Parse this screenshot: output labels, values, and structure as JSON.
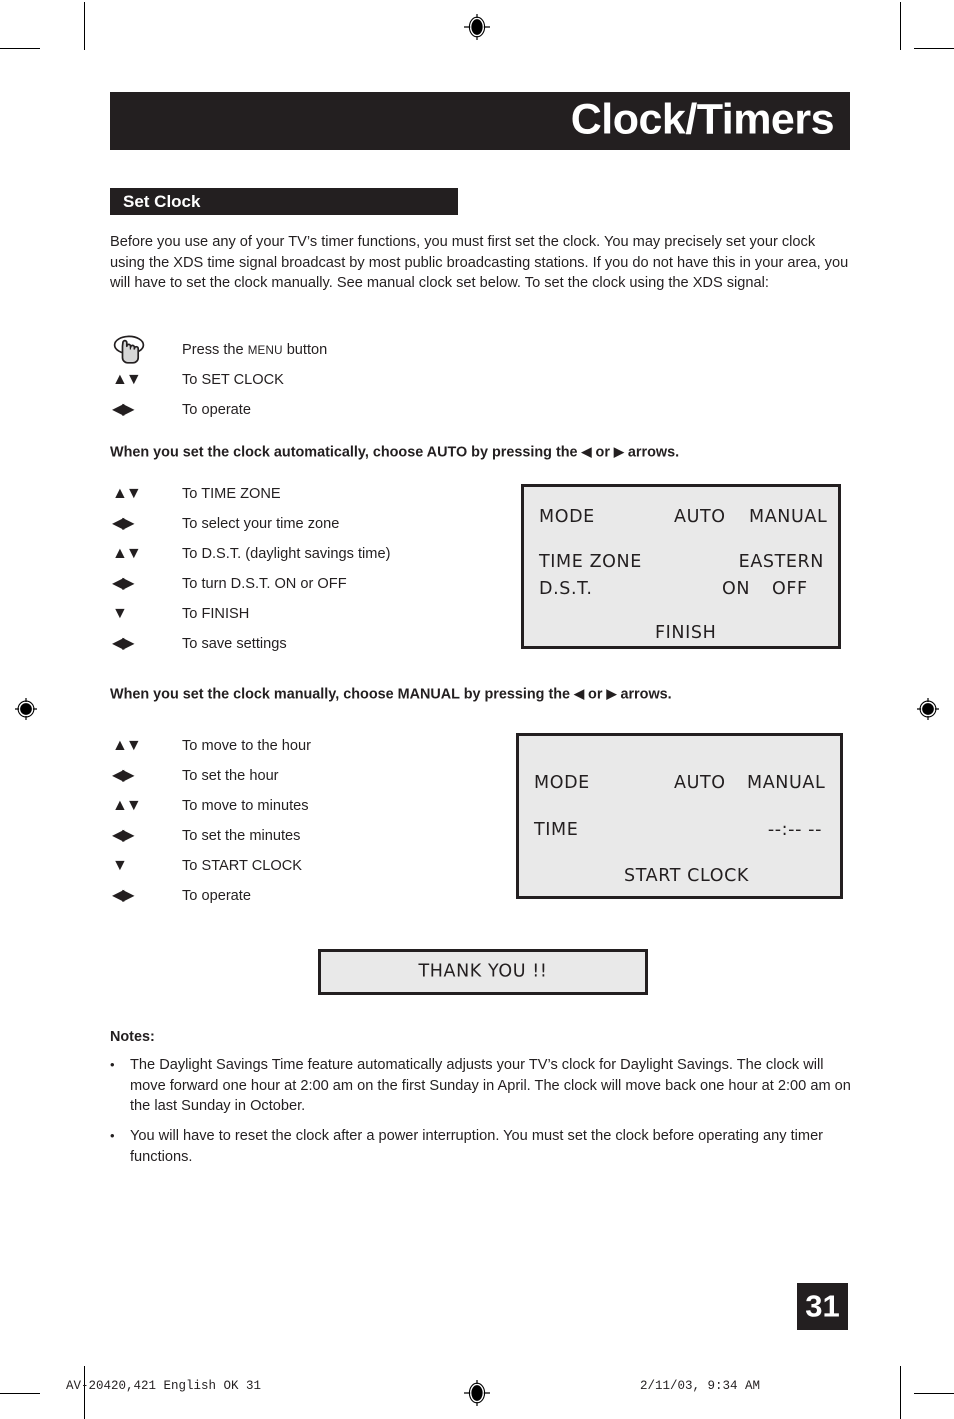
{
  "document": {
    "page_title": "Clock/Timers",
    "section_title": "Set Clock",
    "page_number": "31"
  },
  "intro": {
    "paragraph": "Before you use any of your TV’s timer functions, you must first set the clock. You may precisely set your clock using the XDS time signal broadcast by most public broadcasting stations. If you do not have this in your area, you will have to set the clock manually. See manual clock set below. To set the clock using the XDS signal:"
  },
  "menu_steps": [
    {
      "key": "press-button",
      "icon": "hand-press-icon",
      "label_before": "Press the ",
      "label_smallcaps": "MENU",
      "label_after": " button"
    },
    {
      "key": "▲▼",
      "icon": "up-down-arrows-icon",
      "label": "To SET CLOCK"
    },
    {
      "key": "◀▶",
      "icon": "left-right-arrows-icon",
      "label": "To operate"
    }
  ],
  "auto_section": {
    "lead_before": "When you set the clock automatically, choose AUTO by pressing the ",
    "lead_arrow_left": "◀",
    "lead_mid": " or ",
    "lead_arrow_right": "▶",
    "lead_after": " arrows.",
    "steps": [
      {
        "key": "▲▼",
        "icon": "up-down-arrows-icon",
        "label": "To TIME ZONE"
      },
      {
        "key": "◀▶",
        "icon": "left-right-arrows-icon",
        "label": "To select your time zone"
      },
      {
        "key": "▲▼",
        "icon": "up-down-arrows-icon",
        "label": "To D.S.T. (daylight savings time)"
      },
      {
        "key": "◀▶",
        "icon": "left-right-arrows-icon",
        "label": "To turn D.S.T. ON or OFF"
      },
      {
        "key": "▼",
        "icon": "down-arrow-icon",
        "label": "To FINISH"
      },
      {
        "key": "◀▶",
        "icon": "left-right-arrows-icon",
        "label": "To save settings"
      }
    ],
    "osd": {
      "mode_label": "MODE",
      "mode_option_auto": "AUTO",
      "mode_option_manual": "MANUAL",
      "time_zone_label": "TIME ZONE",
      "time_zone_value": "EASTERN",
      "dst_label": "D.S.T.",
      "dst_option_on": "ON",
      "dst_option_off": "OFF",
      "finish_label": "FINISH"
    }
  },
  "manual_section": {
    "lead_before": "When you set the clock manually, choose MANUAL by pressing the ",
    "lead_arrow_left": "◀",
    "lead_mid": " or ",
    "lead_arrow_right": "▶",
    "lead_after": " arrows.",
    "steps": [
      {
        "key": "▲▼",
        "icon": "up-down-arrows-icon",
        "label": "To move to the hour"
      },
      {
        "key": "◀▶",
        "icon": "left-right-arrows-icon",
        "label": "To set the hour"
      },
      {
        "key": "▲▼",
        "icon": "up-down-arrows-icon",
        "label": "To move to minutes"
      },
      {
        "key": "◀▶",
        "icon": "left-right-arrows-icon",
        "label": "To set the minutes"
      },
      {
        "key": "▼",
        "icon": "down-arrow-icon",
        "label": "To START CLOCK"
      },
      {
        "key": "◀▶",
        "icon": "left-right-arrows-icon",
        "label": "To operate"
      }
    ],
    "osd": {
      "mode_label": "MODE",
      "mode_option_auto": "AUTO",
      "mode_option_manual": "MANUAL",
      "time_label": "TIME",
      "time_value": "--:-- --",
      "start_clock_label": "START CLOCK"
    }
  },
  "thank_you": {
    "message": "THANK YOU !!"
  },
  "notes": {
    "title": "Notes:",
    "bullet": "•",
    "items": [
      "The Daylight Savings Time feature automatically adjusts your TV’s clock for Daylight Savings. The clock will move forward one hour at 2:00 am on the first Sunday in April. The clock will move back one hour at 2:00 am on the last Sunday in October.",
      "You will have to reset the clock after a power interruption. You must set the clock before operating any timer functions."
    ]
  },
  "printer_footer": {
    "left": "AV-20420,421 English OK   31",
    "right": "2/11/03, 9:34 AM"
  },
  "colors": {
    "ink": "#231f20",
    "osd_screen": "#e9e9e9",
    "paper": "#ffffff"
  }
}
